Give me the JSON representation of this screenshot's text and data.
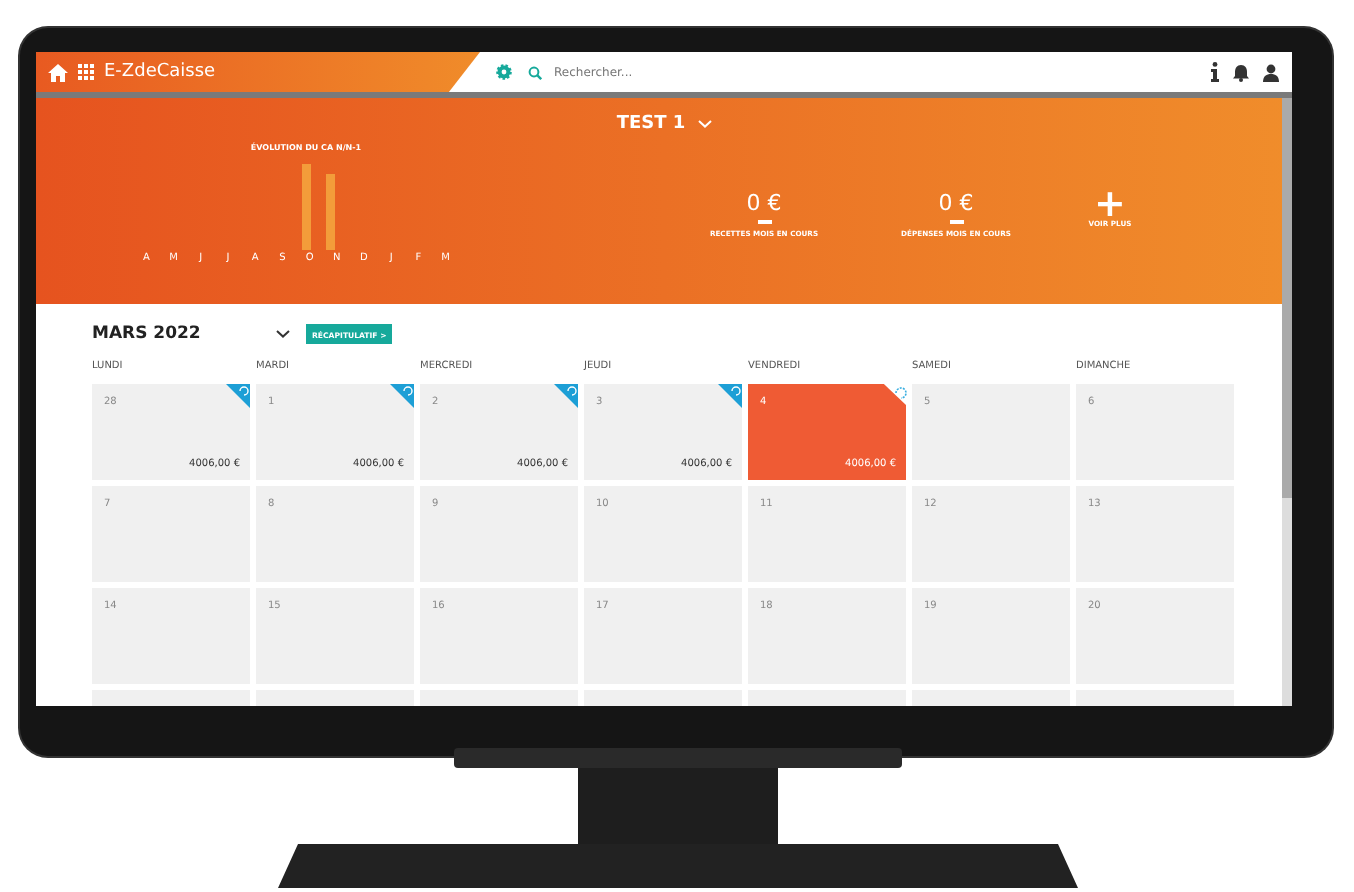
{
  "top_bar": {
    "app_name": "E-ZdeCaisse",
    "search": {
      "placeholder": "Rechercher..."
    }
  },
  "header": {
    "store": "TEST 1",
    "chart_title": "ÉVOLUTION DU CA N/N-1",
    "months": [
      "A",
      "M",
      "J",
      "J",
      "A",
      "S",
      "O",
      "N",
      "D",
      "J",
      "F",
      "M"
    ],
    "stats": [
      {
        "kind": "value",
        "value": "0 €",
        "label": "RECETTES MOIS EN COURS"
      },
      {
        "kind": "value",
        "value": "0 €",
        "label": "DÉPENSES MOIS EN COURS"
      },
      {
        "kind": "more",
        "value": "+",
        "label": "VOIR PLUS"
      }
    ]
  },
  "calendar": {
    "month": "MARS 2022",
    "summary_button": "RÉCAPITULATIF >",
    "weekdays": [
      "LUNDI",
      "MARDI",
      "MERCREDI",
      "JEUDI",
      "VENDREDI",
      "SAMEDI",
      "DIMANCHE"
    ],
    "weeks": [
      [
        {
          "day": "28",
          "amount": "4006,00 €",
          "synced": true,
          "selected": false
        },
        {
          "day": "1",
          "amount": "4006,00 €",
          "synced": true,
          "selected": false
        },
        {
          "day": "2",
          "amount": "4006,00 €",
          "synced": true,
          "selected": false
        },
        {
          "day": "3",
          "amount": "4006,00 €",
          "synced": true,
          "selected": false
        },
        {
          "day": "4",
          "amount": "4006,00 €",
          "synced": true,
          "selected": true
        },
        {
          "day": "5",
          "synced": false,
          "selected": false
        },
        {
          "day": "6",
          "synced": false,
          "selected": false
        }
      ],
      [
        {
          "day": "7",
          "synced": false,
          "selected": false
        },
        {
          "day": "8",
          "synced": false,
          "selected": false
        },
        {
          "day": "9",
          "synced": false,
          "selected": false
        },
        {
          "day": "10",
          "synced": false,
          "selected": false
        },
        {
          "day": "11",
          "synced": false,
          "selected": false
        },
        {
          "day": "12",
          "synced": false,
          "selected": false
        },
        {
          "day": "13",
          "synced": false,
          "selected": false
        }
      ],
      [
        {
          "day": "14",
          "synced": false,
          "selected": false
        },
        {
          "day": "15",
          "synced": false,
          "selected": false
        },
        {
          "day": "16",
          "synced": false,
          "selected": false
        },
        {
          "day": "17",
          "synced": false,
          "selected": false
        },
        {
          "day": "18",
          "synced": false,
          "selected": false
        },
        {
          "day": "19",
          "synced": false,
          "selected": false
        },
        {
          "day": "20",
          "synced": false,
          "selected": false
        }
      ]
    ]
  }
}
